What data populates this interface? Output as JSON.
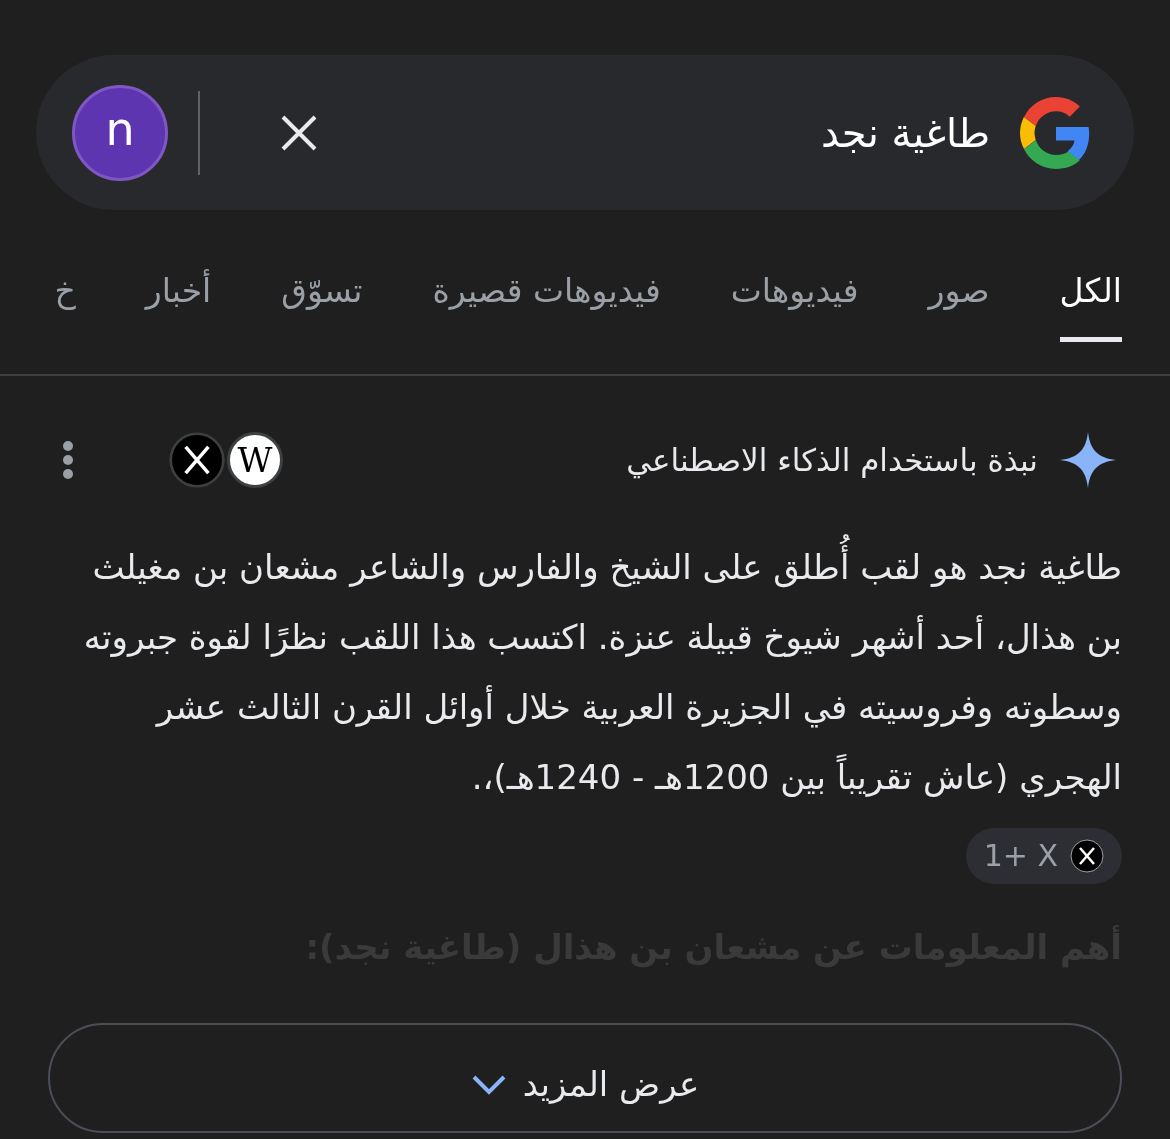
{
  "search": {
    "query": "طاغية نجد",
    "avatar_letter": "n"
  },
  "tabs": [
    {
      "label": "الكل",
      "selected": true
    },
    {
      "label": "صور",
      "selected": false
    },
    {
      "label": "فيديوهات",
      "selected": false
    },
    {
      "label": "فيديوهات قصيرة",
      "selected": false
    },
    {
      "label": "تسوّق",
      "selected": false
    },
    {
      "label": "أخبار",
      "selected": false
    },
    {
      "label": "خ",
      "selected": false
    }
  ],
  "ai_overview": {
    "title": "نبذة باستخدام الذكاء الاصطناعي",
    "source_glyph": "W",
    "paragraph": "طاغية نجد هو لقب أُطلق على الشيخ والفارس والشاعر مشعان بن مغيلث بن هذال، أحد أشهر شيوخ قبيلة عنزة. اكتسب هذا اللقب نظرًا لقوة جبروته وسطوته وفروسيته في الجزيرة العربية خلال أوائل القرن الثالث عشر الهجري (عاش تقريباً بين 1200هـ - 1240هـ)،.",
    "source_chip": "1+ X",
    "subheading": "أهم المعلومات عن مشعان بن هذال (طاغية نجد):",
    "show_more": "عرض المزيد"
  }
}
